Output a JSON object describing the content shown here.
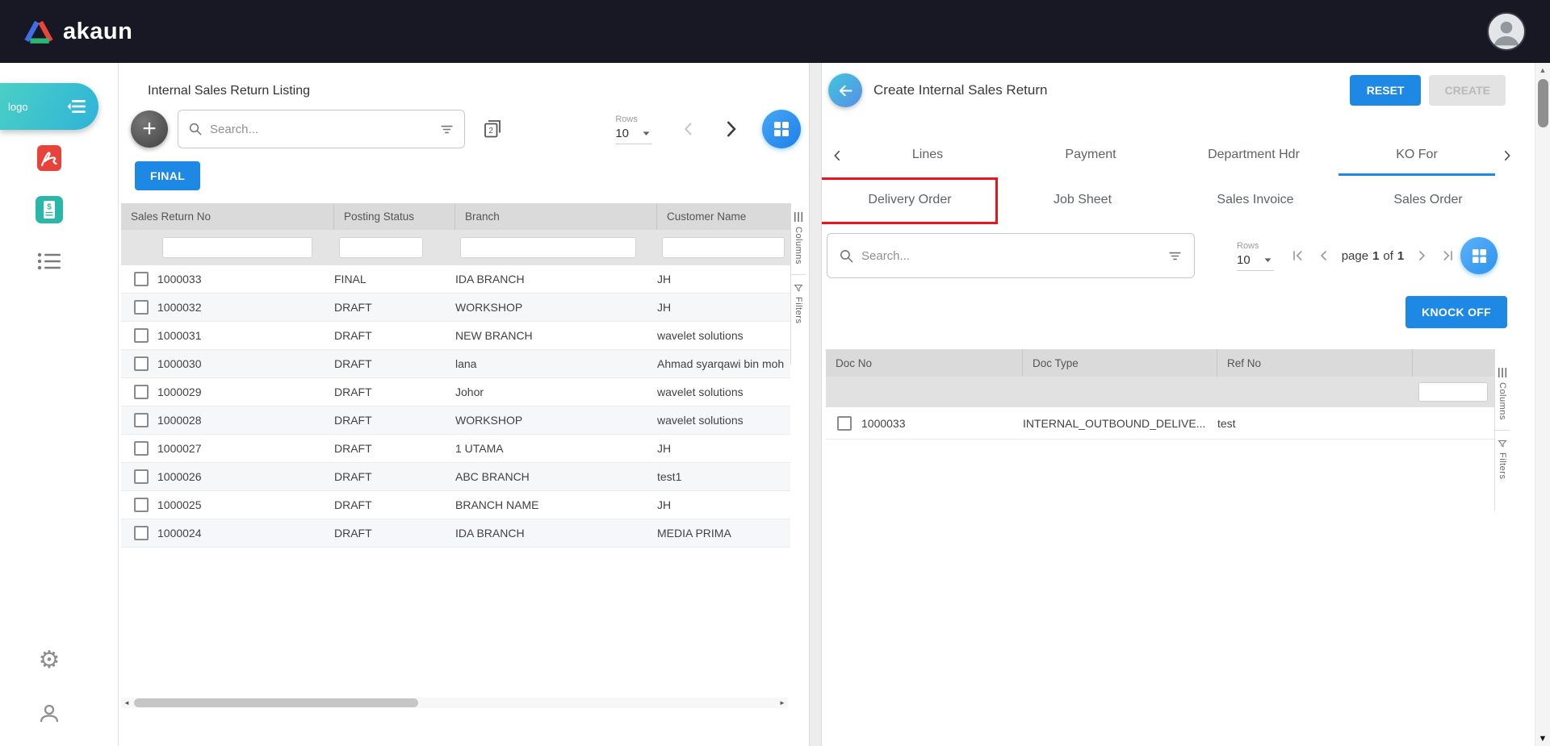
{
  "topbar": {
    "brand": "akaun"
  },
  "sidebar": {
    "logo_text": "logo"
  },
  "left_panel": {
    "title": "Internal Sales Return Listing",
    "toolbar": {
      "search_placeholder": "Search...",
      "rows_label": "Rows",
      "rows_value": "10"
    },
    "final_button": "FINAL",
    "table": {
      "headers": [
        "Sales Return No",
        "Posting Status",
        "Branch",
        "Customer Name"
      ],
      "rows": [
        [
          "1000033",
          "FINAL",
          "IDA BRANCH",
          "JH"
        ],
        [
          "1000032",
          "DRAFT",
          "WORKSHOP",
          "JH"
        ],
        [
          "1000031",
          "DRAFT",
          "NEW BRANCH",
          "wavelet solutions"
        ],
        [
          "1000030",
          "DRAFT",
          "lana",
          "Ahmad syarqawi bin moh"
        ],
        [
          "1000029",
          "DRAFT",
          "Johor",
          "wavelet solutions"
        ],
        [
          "1000028",
          "DRAFT",
          "WORKSHOP",
          "wavelet solutions"
        ],
        [
          "1000027",
          "DRAFT",
          "1 UTAMA",
          "JH"
        ],
        [
          "1000026",
          "DRAFT",
          "ABC BRANCH",
          "test1"
        ],
        [
          "1000025",
          "DRAFT",
          "BRANCH NAME",
          "JH"
        ],
        [
          "1000024",
          "DRAFT",
          "IDA BRANCH",
          "MEDIA PRIMA"
        ]
      ]
    },
    "rail": {
      "columns": "Columns",
      "filters": "Filters"
    }
  },
  "right_panel": {
    "title": "Create Internal Sales Return",
    "reset_button": "RESET",
    "create_button": "CREATE",
    "tabs": [
      {
        "label": "Lines"
      },
      {
        "label": "Payment"
      },
      {
        "label": "Department Hdr"
      },
      {
        "label": "KO For"
      }
    ],
    "active_tab": "KO For",
    "subtabs": [
      {
        "label": "Delivery Order",
        "highlighted": true
      },
      {
        "label": "Job Sheet",
        "highlighted": false
      },
      {
        "label": "Sales Invoice",
        "highlighted": false
      },
      {
        "label": "Sales Order",
        "highlighted": false
      }
    ],
    "toolbar": {
      "search_placeholder": "Search...",
      "rows_label": "Rows",
      "rows_value": "10",
      "page_label": "page",
      "page_current": "1",
      "of_label": "of",
      "page_total": "1"
    },
    "knock_off_button": "KNOCK OFF",
    "table": {
      "headers": [
        "Doc No",
        "Doc Type",
        "Ref No"
      ],
      "rows": [
        [
          "1000033",
          "INTERNAL_OUTBOUND_DELIVE...",
          "test"
        ]
      ]
    },
    "rail": {
      "columns": "Columns",
      "filters": "Filters"
    }
  },
  "icons": {
    "plus": "+",
    "gear": "⚙",
    "scroll_up": "▲",
    "scroll_down": "▼",
    "scroll_left": "◄",
    "scroll_right": "►"
  },
  "colors": {
    "topbar_bg": "#181825",
    "accent_blue": "#1e88e5",
    "teal": "#38c3d4",
    "highlight_red": "#e9151b",
    "table_header_bg": "#dadada",
    "disabled_button_bg": "#e3e3e3"
  }
}
